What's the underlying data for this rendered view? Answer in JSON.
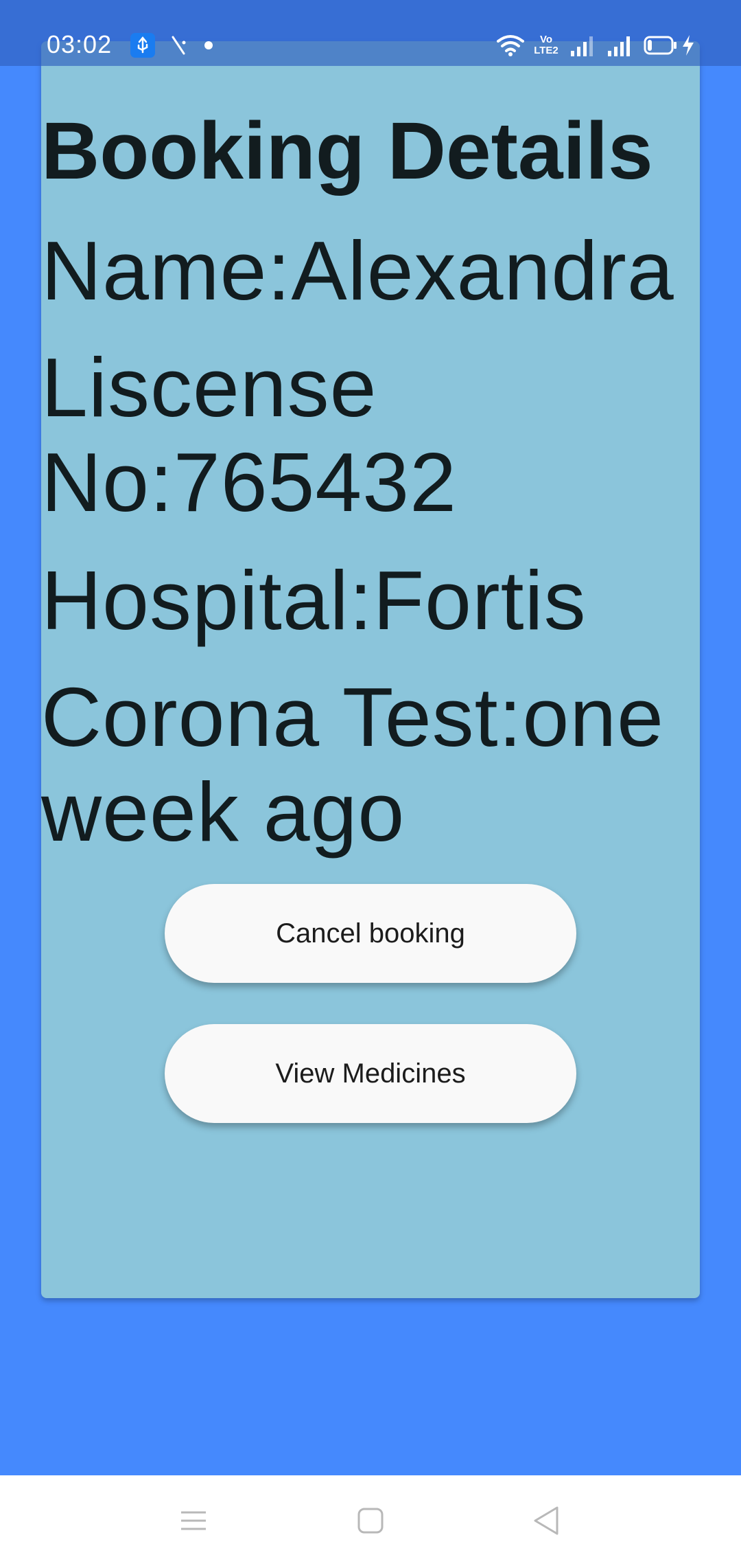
{
  "status_bar": {
    "time": "03:02",
    "volte_label": "Vo LTE2",
    "left_icons": [
      "usb-debug-icon",
      "antenna-icon",
      "notification-dot-icon"
    ],
    "right_icons": [
      "wifi-icon",
      "volte-icon",
      "signal-icon",
      "signal-icon",
      "battery-icon",
      "charging-icon"
    ],
    "battery_level": 0.2
  },
  "booking": {
    "title": "Booking Details",
    "name": "Name:Alexandra",
    "license_line1": "Liscense",
    "license_line2": "No:765432",
    "hospital": "Hospital:Fortis",
    "corona_line1": "Corona Test:one",
    "corona_line2": "week ago"
  },
  "actions": {
    "cancel_label": "Cancel booking",
    "view_medicines_label": "View Medicines"
  },
  "nav_bar": {
    "icons": [
      "menu-icon",
      "home-icon",
      "back-icon"
    ]
  },
  "colors": {
    "background": "#4589fd",
    "card": "#8bc5db",
    "text": "#121c1f",
    "button": "#f9f9f9"
  }
}
